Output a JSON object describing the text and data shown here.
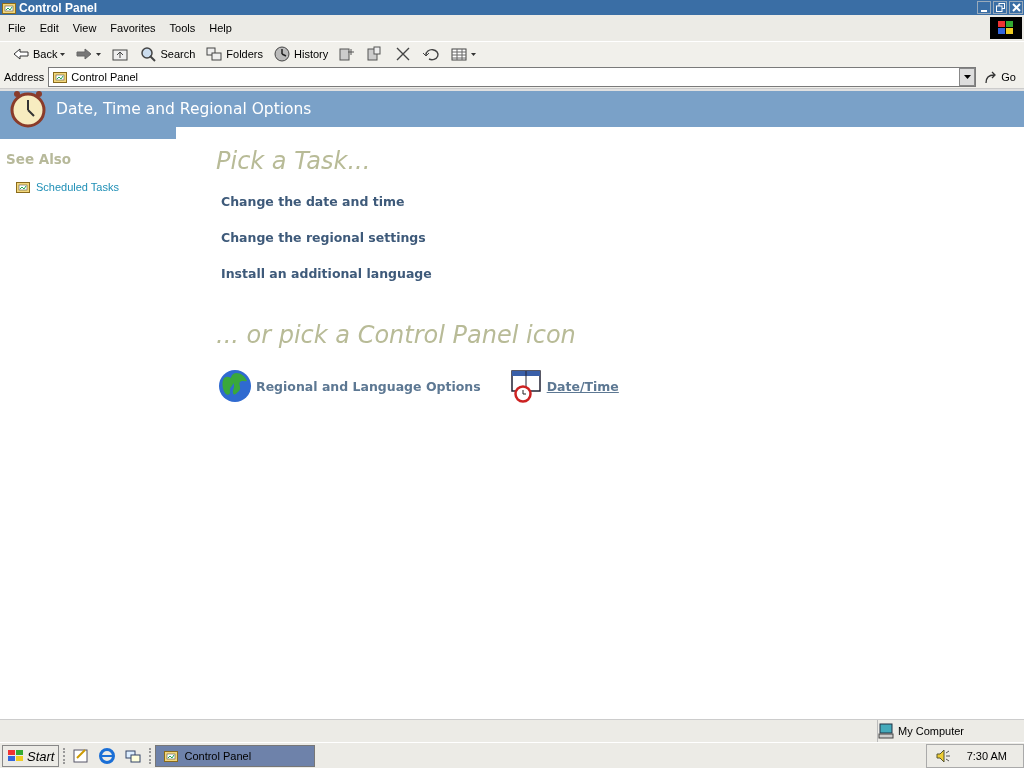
{
  "window": {
    "title": "Control Panel"
  },
  "menu": [
    "File",
    "Edit",
    "View",
    "Favorites",
    "Tools",
    "Help"
  ],
  "toolbar": [
    {
      "kind": "back",
      "label": "Back",
      "dropdown": true
    },
    {
      "kind": "forward",
      "dropdown": true
    },
    {
      "kind": "up"
    },
    {
      "kind": "search",
      "label": "Search"
    },
    {
      "kind": "folders",
      "label": "Folders"
    },
    {
      "kind": "history",
      "label": "History"
    },
    {
      "kind": "move"
    },
    {
      "kind": "copy"
    },
    {
      "kind": "delete"
    },
    {
      "kind": "undo"
    },
    {
      "kind": "views",
      "dropdown": true
    }
  ],
  "address": {
    "label": "Address",
    "value": "Control Panel",
    "go": "Go"
  },
  "header": {
    "title": "Date, Time and Regional Options"
  },
  "see_also": {
    "title": "See Also",
    "items": [
      "Scheduled Tasks"
    ]
  },
  "tasks": {
    "heading": "Pick a Task...",
    "items": [
      "Change the date and time",
      "Change the regional settings",
      "Install an additional language"
    ]
  },
  "icons": {
    "heading": "... or pick a Control Panel icon",
    "items": [
      {
        "kind": "globe",
        "label": "Regional and Language Options",
        "hovered": false
      },
      {
        "kind": "calendar",
        "label": "Date/Time",
        "hovered": true
      }
    ]
  },
  "status_bar": {
    "zone": "My Computer"
  },
  "taskbar": {
    "start": "Start",
    "quick_launch": [
      {
        "kind": "desktop"
      },
      {
        "kind": "browser"
      },
      {
        "kind": "window-switch"
      }
    ],
    "tasks": [
      {
        "label": "Control Panel",
        "selected": true
      }
    ],
    "time": "7:30 AM"
  }
}
